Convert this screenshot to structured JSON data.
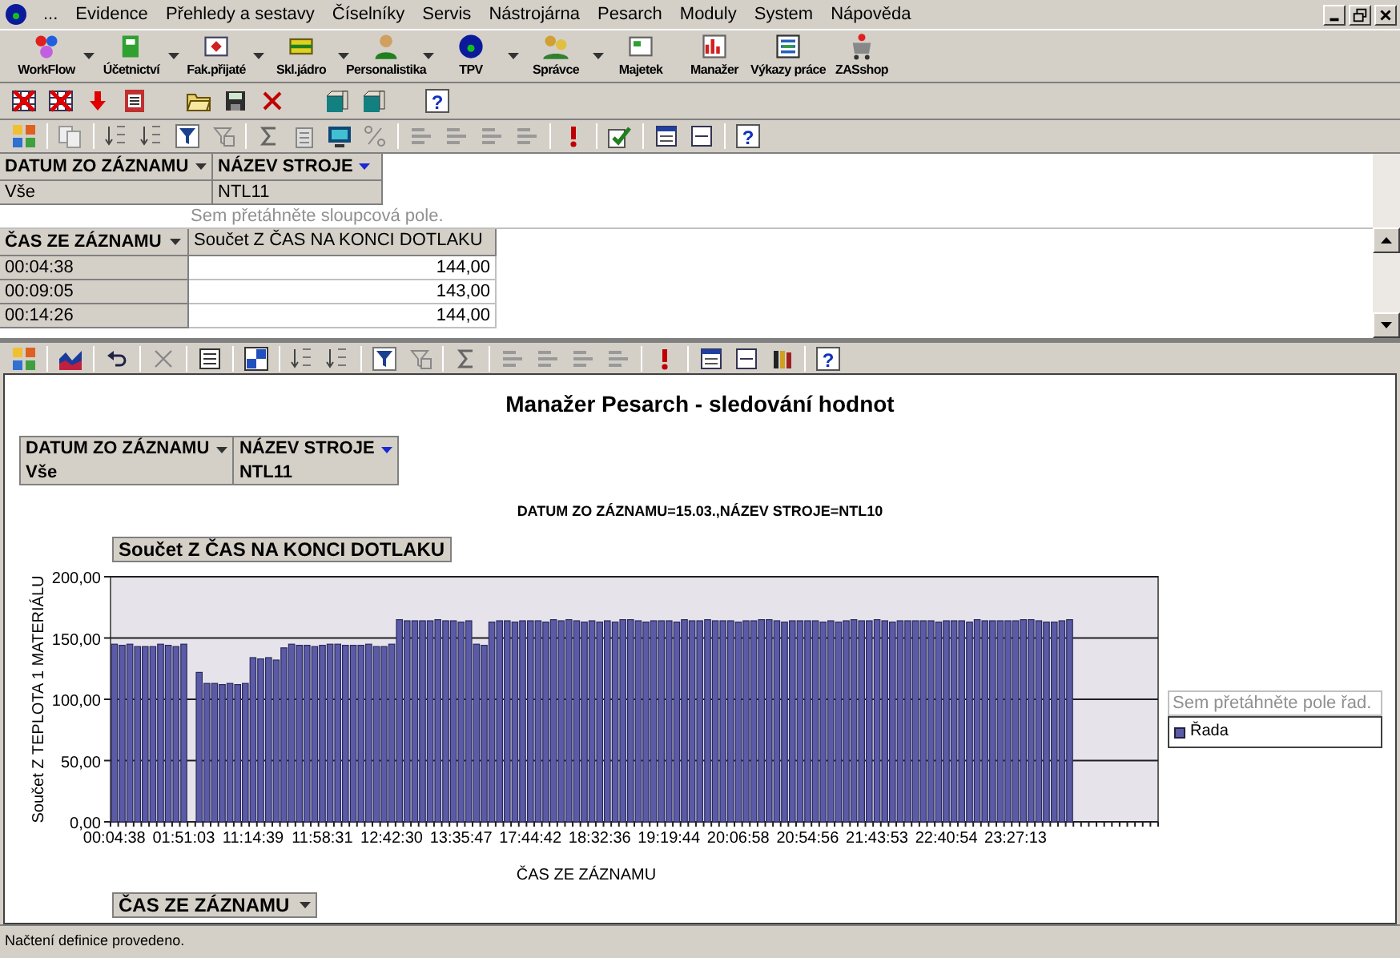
{
  "menu_bar": {
    "more": "...",
    "items": [
      "Evidence",
      "Přehledy a sestavy",
      "Číselníky",
      "Servis",
      "Nástrojárna",
      "Pesarch",
      "Moduly",
      "System",
      "Nápověda"
    ]
  },
  "modules": [
    {
      "label": "WorkFlow",
      "dropdown": true
    },
    {
      "label": "Účetnictví",
      "dropdown": true
    },
    {
      "label": "Fak.přijaté",
      "dropdown": true
    },
    {
      "label": "Skl.jádro",
      "dropdown": true
    },
    {
      "label": "Personalistika",
      "dropdown": true
    },
    {
      "label": "TPV",
      "dropdown": true
    },
    {
      "label": "Správce",
      "dropdown": true
    },
    {
      "label": "Majetek",
      "dropdown": false
    },
    {
      "label": "Manažer",
      "dropdown": false
    },
    {
      "label": "Výkazy práce",
      "dropdown": false
    },
    {
      "label": "ZASshop",
      "dropdown": false
    }
  ],
  "pivot": {
    "filter_fields": [
      {
        "label": "DATUM ZO ZÁZNAMU",
        "filtered": false
      },
      {
        "label": "NÁZEV STROJE",
        "filtered": true
      }
    ],
    "filter_values": [
      "Vše",
      "NTL11"
    ],
    "column_drop_hint": "Sem přetáhněte sloupcová pole.",
    "row_field": "ČAS ZE ZÁZNAMU",
    "data_field": "Součet Z ČAS NA KONCI DOTLAKU",
    "rows": [
      {
        "time": "00:04:38",
        "value": "144,00"
      },
      {
        "time": "00:09:05",
        "value": "143,00"
      },
      {
        "time": "00:14:26",
        "value": "144,00"
      }
    ]
  },
  "chart_panel": {
    "title": "Manažer Pesarch - sledování hodnot",
    "filter_fields": [
      {
        "label": "DATUM ZO ZÁZNAMU",
        "filtered": false
      },
      {
        "label": "NÁZEV STROJE",
        "filtered": true
      }
    ],
    "filter_values": [
      "Vše",
      "NTL11"
    ],
    "subtitle": "DATUM ZO ZÁZNAMU=15.03.,NÁZEV STROJE=NTL10",
    "data_field_button": "Součet Z ČAS NA KONCI DOTLAKU",
    "category_button": "ČAS ZE ZÁZNAMU",
    "legend_hint": "Sem přetáhněte pole řad.",
    "chart_data": {
      "type": "bar",
      "xlabel": "ČAS ZE ZÁZNAMU",
      "ylabel": "Součet Z TEPLOTA 1 MATERIÁLU",
      "ylim": [
        0,
        200
      ],
      "grid": true,
      "categories": [
        "00:04:38",
        null,
        null,
        null,
        null,
        null,
        null,
        null,
        null,
        "01:51:03",
        null,
        null,
        null,
        null,
        null,
        null,
        null,
        null,
        "11:14:39",
        null,
        null,
        null,
        null,
        null,
        null,
        null,
        null,
        "11:58:31",
        null,
        null,
        null,
        null,
        null,
        null,
        null,
        null,
        "12:42:30",
        null,
        null,
        null,
        null,
        null,
        null,
        null,
        null,
        "13:35:47",
        null,
        null,
        null,
        null,
        null,
        null,
        null,
        null,
        "17:44:42",
        null,
        null,
        null,
        null,
        null,
        null,
        null,
        null,
        "18:32:36",
        null,
        null,
        null,
        null,
        null,
        null,
        null,
        null,
        "19:19:44",
        null,
        null,
        null,
        null,
        null,
        null,
        null,
        null,
        "20:06:58",
        null,
        null,
        null,
        null,
        null,
        null,
        null,
        null,
        "20:54:56",
        null,
        null,
        null,
        null,
        null,
        null,
        null,
        null,
        "21:43:53",
        null,
        null,
        null,
        null,
        null,
        null,
        null,
        null,
        "22:40:54",
        null,
        null,
        null,
        null,
        null,
        null,
        null,
        null,
        "23:27:13",
        null,
        null,
        null,
        null,
        null,
        null,
        null,
        null,
        null,
        null,
        null,
        null,
        null,
        null,
        null,
        null,
        null,
        null
      ],
      "yticks": [
        {
          "value": 0,
          "label": "0,00"
        },
        {
          "value": 50,
          "label": "50,00"
        },
        {
          "value": 100,
          "label": "100,00"
        },
        {
          "value": 150,
          "label": "150,00"
        },
        {
          "value": 200,
          "label": "200,00"
        }
      ],
      "series": [
        {
          "name": "Řada",
          "color": "#5a5aa6",
          "values": [
            145,
            144,
            145,
            143,
            143,
            143,
            145,
            144,
            143,
            145,
            null,
            122,
            113,
            113,
            112,
            113,
            112,
            113,
            134,
            133,
            134,
            132,
            142,
            145,
            144,
            144,
            143,
            144,
            145,
            145,
            144,
            144,
            144,
            145,
            143,
            143,
            145,
            165,
            164,
            164,
            164,
            164,
            165,
            164,
            164,
            163,
            164,
            145,
            144,
            163,
            164,
            164,
            163,
            164,
            164,
            164,
            163,
            165,
            164,
            165,
            164,
            163,
            164,
            163,
            164,
            163,
            165,
            165,
            164,
            163,
            164,
            164,
            164,
            163,
            165,
            164,
            164,
            165,
            164,
            164,
            164,
            163,
            164,
            164,
            165,
            165,
            164,
            163,
            164,
            164,
            164,
            164,
            163,
            164,
            163,
            164,
            165,
            164,
            164,
            165,
            164,
            163,
            164,
            164,
            164,
            164,
            164,
            163,
            164,
            164,
            164,
            163,
            165,
            164,
            164,
            164,
            164,
            164,
            165,
            165,
            164,
            163,
            163,
            164,
            165,
            null,
            null,
            null,
            null,
            null,
            null,
            null,
            null,
            null,
            null,
            null
          ]
        }
      ]
    }
  },
  "help_glyphs": [
    "?",
    "?",
    "?"
  ],
  "status_bar": "Načtení definice provedeno."
}
